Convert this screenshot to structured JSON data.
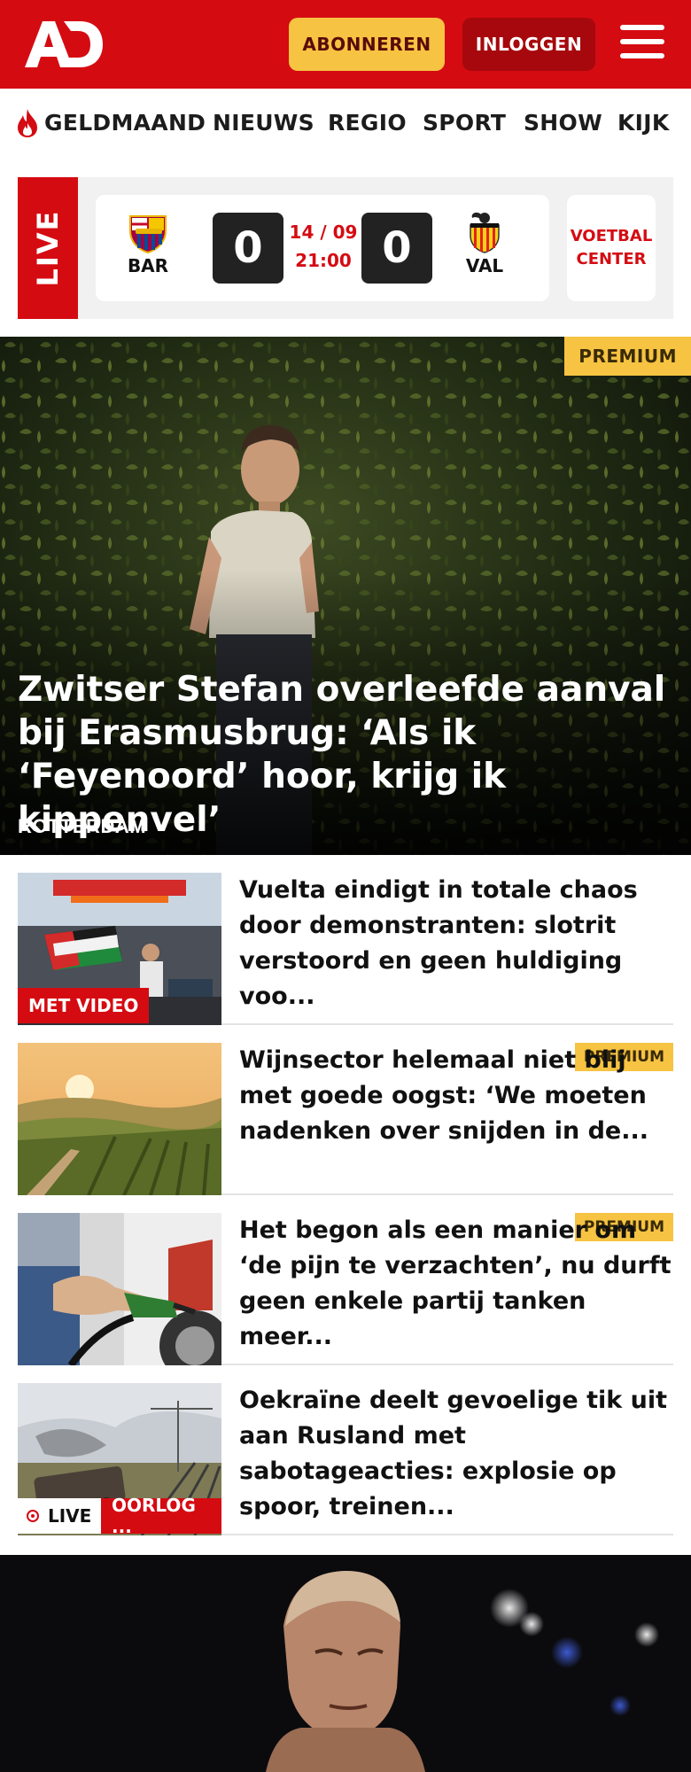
{
  "header": {
    "logo_text": "AD",
    "subscribe_label": "ABONNEREN",
    "login_label": "INLOGGEN",
    "brand_color": "#d50b12",
    "accent_color": "#f6c342"
  },
  "nav": {
    "items": [
      "GELDMAAND",
      "NIEUWS",
      "REGIO",
      "SPORT",
      "SHOW",
      "KIJK"
    ],
    "first_item_icon": "flame-icon"
  },
  "live_match": {
    "live_label": "LIVE",
    "home_code": "BAR",
    "home_score": "0",
    "away_code": "VAL",
    "away_score": "0",
    "date": "14 / 09",
    "time": "21:00",
    "center_label_line1": "VOETBAL",
    "center_label_line2": "CENTER"
  },
  "hero": {
    "badge": "PREMIUM",
    "title": "Zwitser Stefan overleefde aanval bij Erasmusbrug: ‘Als ik ‘Feyenoord’ hoor, krijg ik kippenvel’",
    "kicker": "ROTTERDAM"
  },
  "articles": [
    {
      "title": "Vuelta eindigt in totale chaos door demonstranten: slotrit verstoord en geen huldiging voo...",
      "label": "MET VIDEO"
    },
    {
      "title": "Wijnsector helemaal niet blij met goede oogst: ‘We moeten nadenken over snijden in de...",
      "badge": "PREMIUM"
    },
    {
      "title": "Het begon als een manier om ‘de pijn te verzachten’, nu durft geen enkele partij tanken meer...",
      "badge": "PREMIUM"
    },
    {
      "title": "Oekraïne deelt gevoelige tik uit aan Rusland met sabotageacties: explosie op spoor, treinen...",
      "live_label": "LIVE",
      "category_label": "OORLOG ..."
    }
  ]
}
